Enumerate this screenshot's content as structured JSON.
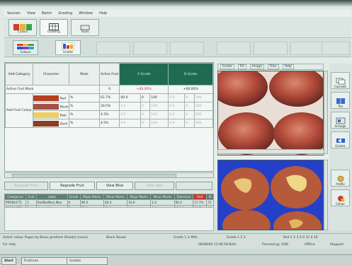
{
  "menu": [
    "Session",
    "View",
    "Batch",
    "Grading",
    "Window",
    "Help"
  ],
  "toolbar": {
    "btn1": "Colour",
    "btn2": "Grading",
    "btn3": "Tools",
    "sub1": "Colours",
    "sub2": "Grades"
  },
  "grid": {
    "headers": {
      "add_category": "Add Category",
      "character": "Character",
      "mask": "Mask",
      "active_fruit": "Active Fruit",
      "a_grade": "A Grade",
      "b_grade": "B Grade"
    },
    "subheader": {
      "label": "Active Fruit Mask",
      "count": "0",
      "a_value": "+00.00%",
      "b_value": "+00.00%"
    },
    "group_label": "Add Fruit Colour",
    "rows": [
      {
        "name": "Red",
        "color": "#b43f22",
        "mask": "%",
        "pct": "61.7%",
        "a": [
          "00.0",
          "0",
          "100"
        ],
        "b": [
          "0.0",
          "0",
          "100"
        ]
      },
      {
        "name": "Blush",
        "color": "#a84f47",
        "mask": "%",
        "pct": "30.5%",
        "a": [
          "0.0",
          "0",
          "100"
        ],
        "b": [
          "0.0",
          "0",
          "100"
        ]
      },
      {
        "name": "Pale",
        "color": "#f0cd5f",
        "mask": "%",
        "pct": "4.3%",
        "a": [
          "0.0",
          "0",
          "100"
        ],
        "b": [
          "0.0",
          "0",
          "100"
        ]
      },
      {
        "name": "Dark",
        "color": "#8a3d22",
        "mask": "%",
        "pct": "4.5%",
        "a": [
          "0.0",
          "0",
          "100"
        ],
        "b": [
          "0.0",
          "0",
          "100"
        ]
      }
    ]
  },
  "buttons": {
    "b1": "Regrade Fruit",
    "b2": "Regrade Fruit",
    "b3": "View Blue",
    "b4": "View Red"
  },
  "lower_table": {
    "headers": [
      "Categories",
      "Fruit",
      "Label",
      "Grade",
      "Major Marks",
      "Minor Marks",
      "Major Marks",
      "Minor Marks",
      "Tolerance",
      "Red",
      "Bl"
    ],
    "rows": [
      [
        "PRODUCT1",
        "1",
        "RedRedRed_Max",
        "A",
        "90.5",
        "20.4",
        "10.6",
        "1.4",
        "92.4",
        "17.7%",
        "72"
      ],
      [
        "PRODUCT2",
        "2",
        "Valed_Min",
        "B",
        "71.0",
        "31.1",
        "1.0",
        "0.9",
        "106.8",
        "51.7%",
        "45"
      ]
    ]
  },
  "image_menu": [
    "Grade",
    "Fill",
    "Image",
    "Files",
    "Help"
  ],
  "right_side": [
    "Cascade",
    "Tile",
    "Arrange",
    "Grades",
    "Profile",
    "Colour"
  ],
  "status": {
    "left": "Select colour Pages by Blues gradient (Ready) (none)",
    "mid1": "Black Shows",
    "mid2": "Grade 1 is fifth",
    "right1": "Grade 1 2 3",
    "right2": "Red 1 2 3 4 0 12 0 16",
    "left2": "For help",
    "date": "06/08/00 11:06:58 Both",
    "proc": "Processing: 5/06",
    "offline": "Offline",
    "stopped": "Stopped"
  },
  "taskbar": {
    "start": "Start",
    "task1": "Fruitscan",
    "task2": "Grades"
  }
}
